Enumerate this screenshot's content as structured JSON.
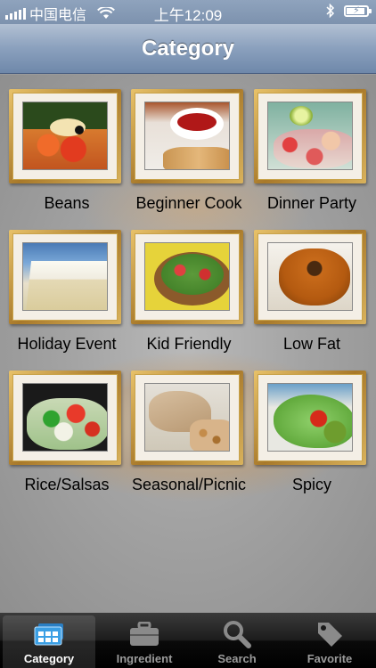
{
  "status_bar": {
    "carrier": "中国电信",
    "time": "上午12:09"
  },
  "nav": {
    "title": "Category"
  },
  "categories": [
    {
      "label": "Beans",
      "photo": "beans"
    },
    {
      "label": "Beginner Cook",
      "photo": "cook"
    },
    {
      "label": "Dinner Party",
      "photo": "dinner"
    },
    {
      "label": "Holiday Event",
      "photo": "holiday"
    },
    {
      "label": "Kid Friendly",
      "photo": "kid"
    },
    {
      "label": "Low Fat",
      "photo": "lowfat"
    },
    {
      "label": "Rice/Salsas",
      "photo": "rice"
    },
    {
      "label": "Seasonal/Picnic",
      "photo": "seasonal"
    },
    {
      "label": "Spicy",
      "photo": "spicy"
    }
  ],
  "tabs": [
    {
      "label": "Category",
      "icon": "category-icon",
      "active": true
    },
    {
      "label": "Ingredient",
      "icon": "briefcase-icon",
      "active": false
    },
    {
      "label": "Search",
      "icon": "search-icon",
      "active": false
    },
    {
      "label": "Favorite",
      "icon": "tag-icon",
      "active": false
    }
  ],
  "colors": {
    "active_tab_icon": "#3b9fe4",
    "inactive_tab_icon": "#8a8a8a",
    "frame_gold": "#c99a3e"
  }
}
